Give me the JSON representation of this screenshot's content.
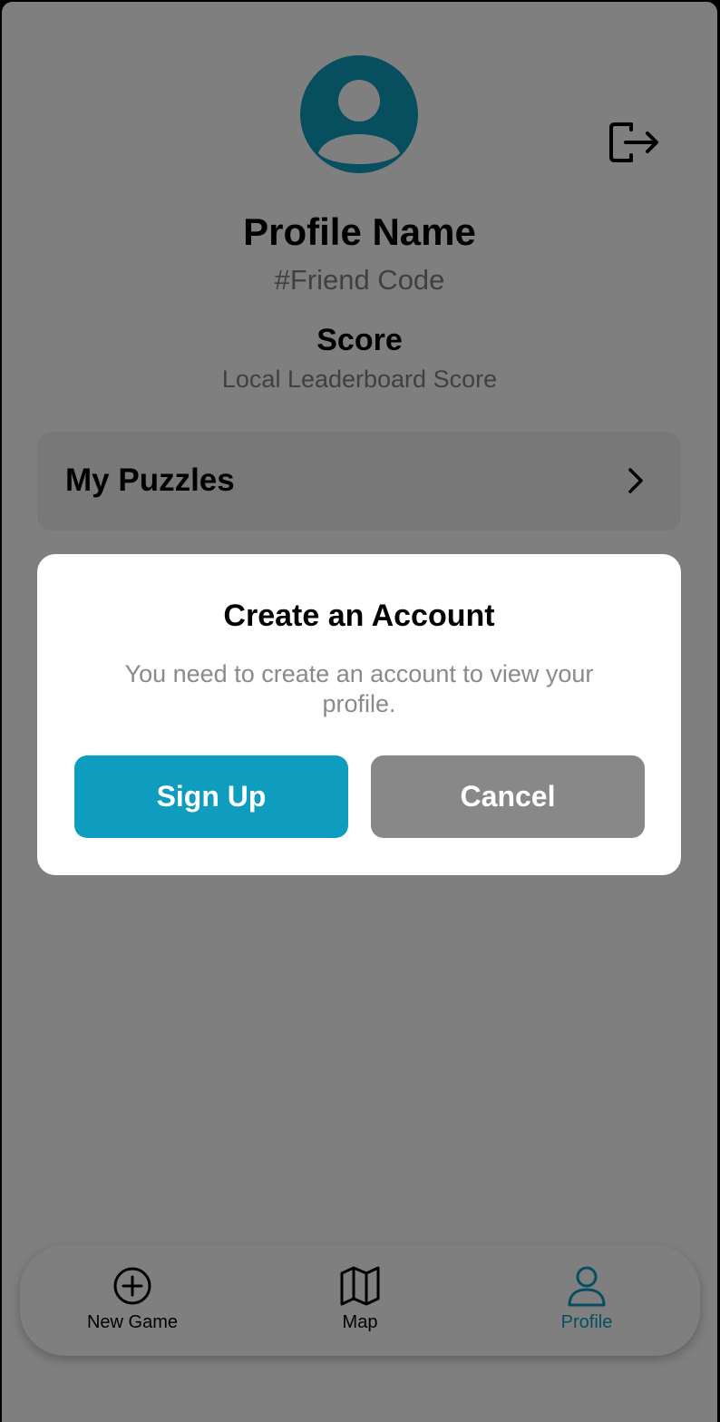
{
  "profile": {
    "name": "Profile Name",
    "friend_code": "#Friend Code",
    "score_label": "Score",
    "score_subtitle": "Local Leaderboard Score"
  },
  "menu": {
    "my_puzzles_label": "My Puzzles"
  },
  "dialog": {
    "title": "Create an Account",
    "message": "You need to create an account to view your profile.",
    "primary_label": "Sign Up",
    "secondary_label": "Cancel"
  },
  "bottom_nav": {
    "items": [
      {
        "label": "New Game",
        "icon": "plus-circle-icon",
        "active": false
      },
      {
        "label": "Map",
        "icon": "map-icon",
        "active": false
      },
      {
        "label": "Profile",
        "icon": "person-icon",
        "active": true
      }
    ]
  },
  "colors": {
    "accent": "#0e9dbf",
    "cancel_button": "#888888",
    "scrim": "rgba(0,0,0,0.5)"
  }
}
